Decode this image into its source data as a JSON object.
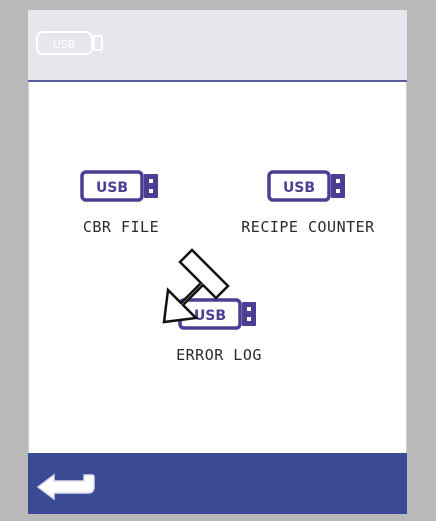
{
  "header": {
    "usb_icon_text": "USB"
  },
  "items": [
    {
      "usb_text": "USB",
      "label": "CBR FILE"
    },
    {
      "usb_text": "USB",
      "label": "RECIPE COUNTER"
    },
    {
      "usb_text": "USB",
      "label": "ERROR LOG"
    }
  ],
  "colors": {
    "usb_purple": "#4b3e93",
    "topbar_bg": "#e6e7ec",
    "bottombar_bg": "#3a4a95",
    "back_arrow": "#ffffff"
  },
  "icons": {
    "header": "usb-drive-outline-icon",
    "item": "usb-drive-icon",
    "pointer": "down-left-arrow-icon",
    "back": "back-arrow-icon"
  }
}
